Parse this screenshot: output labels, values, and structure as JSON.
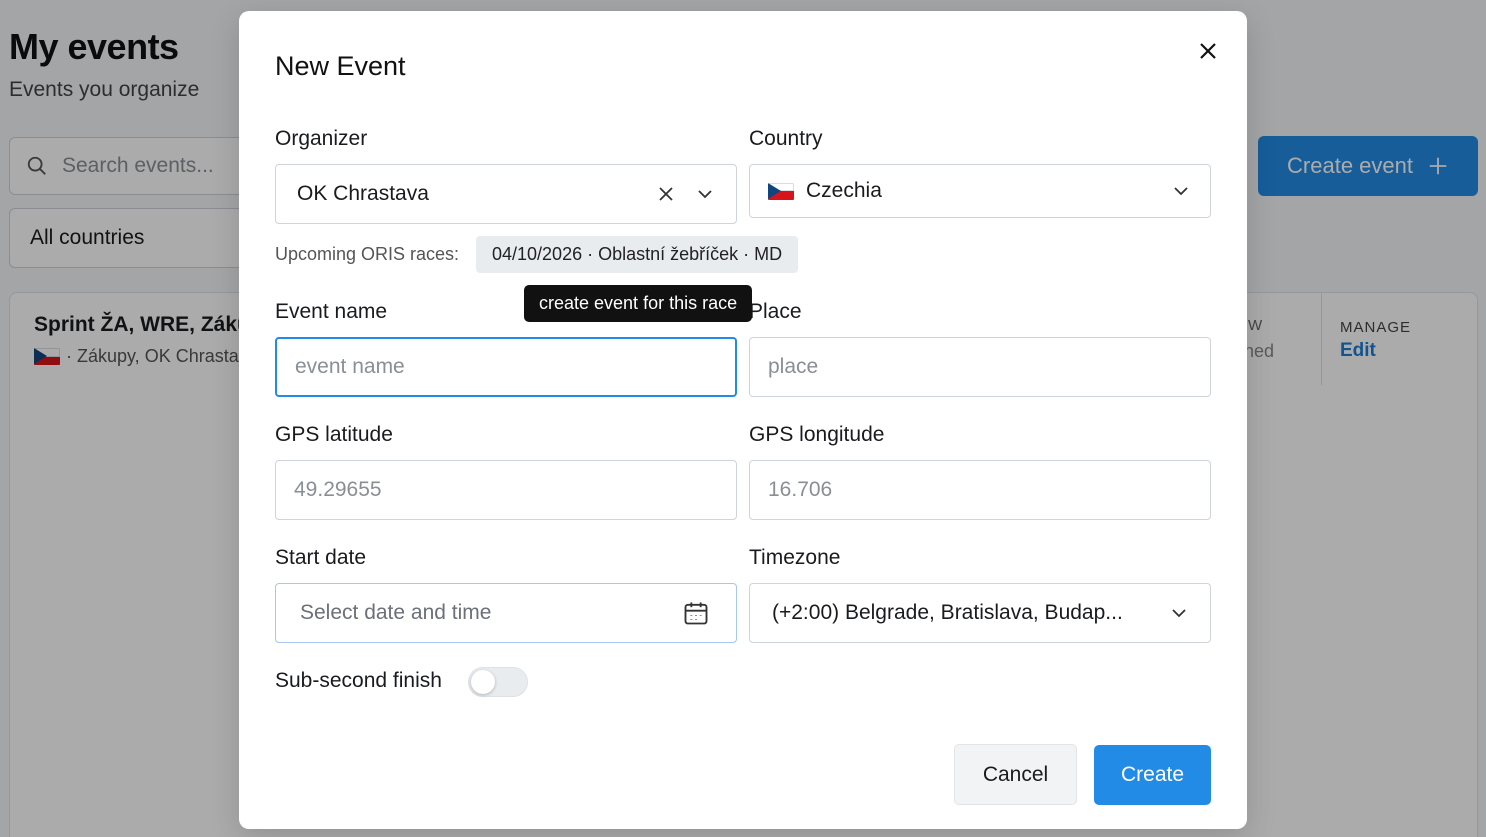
{
  "background": {
    "title": "My events",
    "subtitle": "Events you organize",
    "search_placeholder": "Search events...",
    "countries_filter": "All countries",
    "create_button": "Create event",
    "card": {
      "title": "Sprint ŽA, WRE, Záku",
      "meta": "· Zákupy, OK Chrasta",
      "col_partial_header": "W",
      "col_partial_value": "hed",
      "manage_header": "MANAGE",
      "manage_link": "Edit"
    }
  },
  "modal": {
    "title": "New Event",
    "organizer": {
      "label": "Organizer",
      "value": "OK Chrastava"
    },
    "country": {
      "label": "Country",
      "value": "Czechia"
    },
    "oris": {
      "label": "Upcoming ORIS races:",
      "chip": "04/10/2026 · Oblastní žebříček · MD",
      "tooltip": "create event for this race"
    },
    "event_name": {
      "label": "Event name",
      "placeholder": "event name"
    },
    "place": {
      "label": "Place",
      "placeholder": "place"
    },
    "gps_latitude": {
      "label": "GPS latitude",
      "placeholder": "49.29655"
    },
    "gps_longitude": {
      "label": "GPS longitude",
      "placeholder": "16.706"
    },
    "start_date": {
      "label": "Start date",
      "placeholder": "Select date and time"
    },
    "timezone": {
      "label": "Timezone",
      "value": "(+2:00) Belgrade, Bratislava, Budap..."
    },
    "sub_second": {
      "label": "Sub-second finish",
      "enabled": false
    },
    "cancel_button": "Cancel",
    "create_button": "Create"
  },
  "colors": {
    "accent": "#228be6",
    "link": "#1c7ed6",
    "overlay": "rgba(0,0,0,0.33)"
  }
}
